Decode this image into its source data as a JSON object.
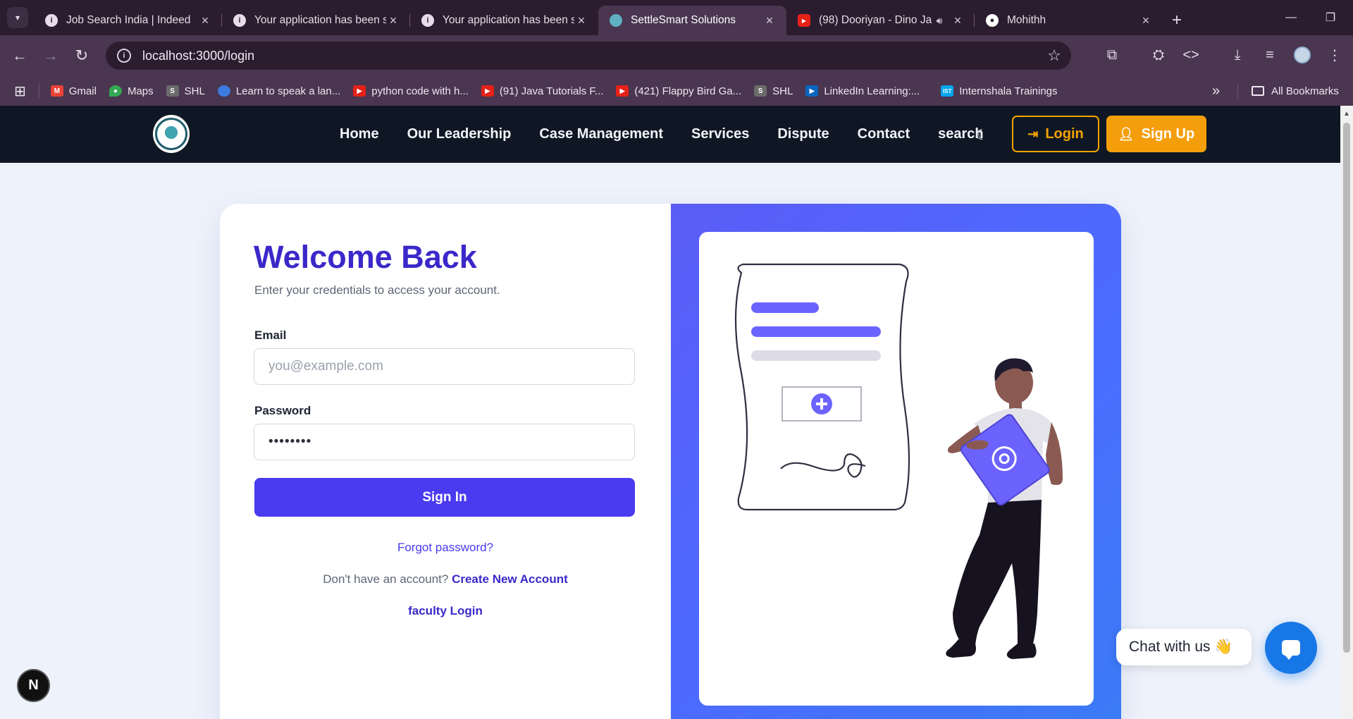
{
  "browser": {
    "tabs": [
      {
        "title": "Job Search India | Indeed",
        "favicon": "info-icon",
        "active": false
      },
      {
        "title": "Your application has been s",
        "favicon": "info-icon",
        "active": false
      },
      {
        "title": "Your application has been s",
        "favicon": "info-icon",
        "active": false
      },
      {
        "title": "SettleSmart Solutions",
        "favicon": "site-logo-icon",
        "active": true
      },
      {
        "title": "(98) Dooriyan - Dino Ja",
        "favicon": "youtube-icon",
        "active": false
      },
      {
        "title": "Mohithh",
        "favicon": "github-icon",
        "active": false
      }
    ],
    "url": "localhost:3000/login",
    "bookmarks": [
      {
        "label": "Gmail",
        "icon": "gmail-icon"
      },
      {
        "label": "Maps",
        "icon": "maps-icon"
      },
      {
        "label": "SHL",
        "icon": "shl-icon"
      },
      {
        "label": "Learn to speak a lan...",
        "icon": "duolingo-icon"
      },
      {
        "label": "python code with h...",
        "icon": "youtube-icon"
      },
      {
        "label": "(91) Java Tutorials F...",
        "icon": "youtube-icon"
      },
      {
        "label": "(421) Flappy Bird Ga...",
        "icon": "youtube-icon"
      },
      {
        "label": "SHL",
        "icon": "shl-icon"
      },
      {
        "label": "LinkedIn Learning:...",
        "icon": "linkedin-learning-icon"
      },
      {
        "label": "Internshala Trainings",
        "icon": "internshala-icon"
      }
    ],
    "all_bookmarks": "All Bookmarks",
    "more_bookmarks": "»"
  },
  "site": {
    "nav": [
      "Home",
      "Our Leadership",
      "Case Management",
      "Services",
      "Dispute",
      "Contact",
      "search"
    ],
    "login_label": "Login",
    "signup_label": "Sign Up"
  },
  "login": {
    "title": "Welcome Back",
    "subtitle": "Enter your credentials to access your account.",
    "email_label": "Email",
    "email_placeholder": "you@example.com",
    "password_label": "Password",
    "password_value": "••••••••",
    "signin_label": "Sign In",
    "forgot": "Forgot password?",
    "no_account": "Don't have an account?",
    "create_account": "Create New Account",
    "faculty_login": "faculty Login"
  },
  "chat": {
    "bubble": "Chat with us 👋"
  },
  "dev_badge": "N",
  "colors": {
    "primary": "#4a3af0",
    "heading": "#3b28c9",
    "accent": "#f59e0b",
    "nav_bg": "#0f1724"
  }
}
